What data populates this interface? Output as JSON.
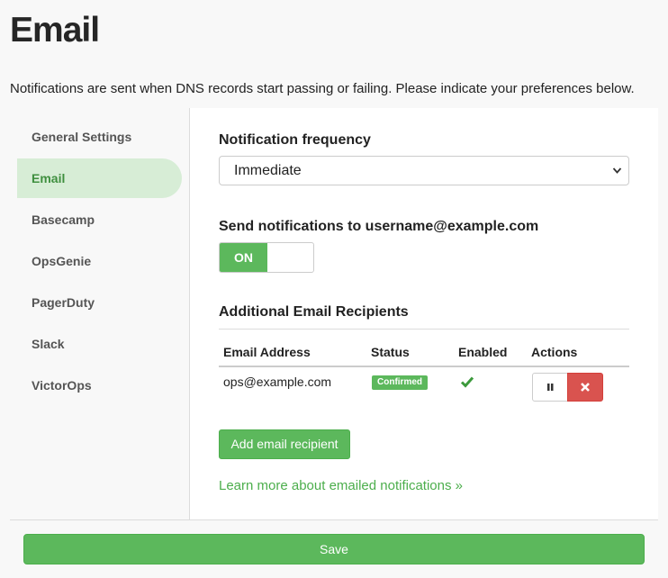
{
  "page": {
    "title": "Email",
    "intro": "Notifications are sent when DNS records start passing or failing. Please indicate your preferences below."
  },
  "sidebar": {
    "items": [
      {
        "label": "General Settings",
        "active": false
      },
      {
        "label": "Email",
        "active": true
      },
      {
        "label": "Basecamp",
        "active": false
      },
      {
        "label": "OpsGenie",
        "active": false
      },
      {
        "label": "PagerDuty",
        "active": false
      },
      {
        "label": "Slack",
        "active": false
      },
      {
        "label": "VictorOps",
        "active": false
      }
    ]
  },
  "form": {
    "frequency_label": "Notification frequency",
    "frequency_value": "Immediate",
    "send_label": "Send notifications to username@example.com",
    "toggle_on_label": "ON",
    "recipients_title": "Additional Email Recipients",
    "table": {
      "headers": [
        "Email Address",
        "Status",
        "Enabled",
        "Actions"
      ],
      "rows": [
        {
          "email": "ops@example.com",
          "status": "Confirmed",
          "enabled": true
        }
      ]
    },
    "add_button": "Add email recipient",
    "learn_more": "Learn more about emailed notifications »"
  },
  "footer": {
    "save_label": "Save"
  },
  "icons": {
    "enabled": "checkmark-icon",
    "pause": "pause-icon",
    "delete": "close-icon",
    "dropdown": "chevron-down-icon"
  },
  "colors": {
    "accent": "#5cb85c",
    "active_bg": "#d7edd6",
    "active_text": "#3f8f3f",
    "danger": "#d9534f",
    "link": "#4cae4c"
  }
}
